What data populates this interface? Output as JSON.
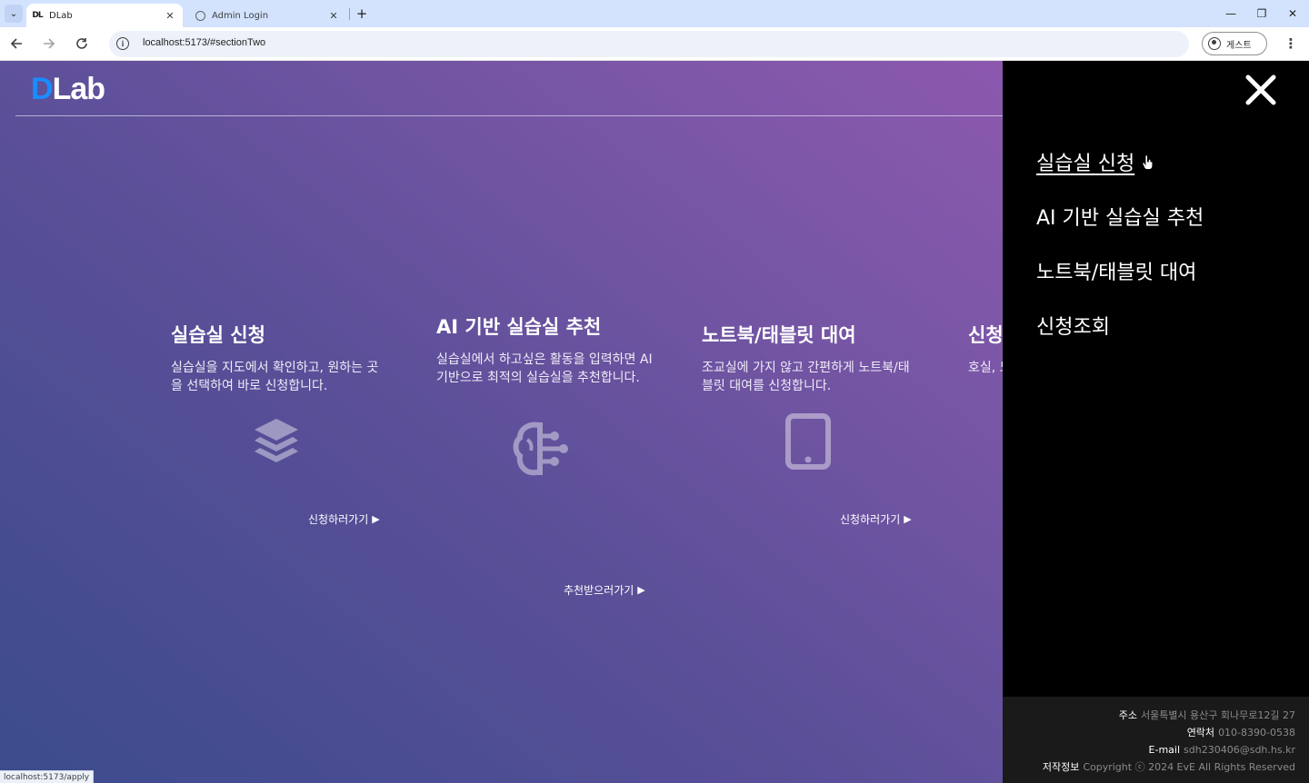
{
  "browser": {
    "tabs": [
      {
        "title": "DLab",
        "favicon": "dlab-favicon",
        "active": true
      },
      {
        "title": "Admin Login",
        "favicon": "globe-icon",
        "active": false
      }
    ],
    "address": "localhost:5173/#sectionTwo",
    "profile_label": "게스트",
    "status_url": "localhost:5173/apply"
  },
  "page": {
    "logo": {
      "first": "D",
      "rest": "Lab",
      "accent": "#1a8cff"
    },
    "cards": [
      {
        "title": "실습실 신청",
        "desc": "실습실을 지도에서 확인하고, 원하는 곳을 선택하여 바로 신청합니다.",
        "icon": "layers-icon",
        "cta": "신청하러가기"
      },
      {
        "title": "AI 기반 실습실 추천",
        "desc": "실습실에서 하고싶은 활동을 입력하면 AI 기반으로 최적의 실습실을 추천합니다.",
        "icon": "ai-brain-icon",
        "cta": "추천받으러가기"
      },
      {
        "title": "노트북/태블릿 대여",
        "desc": "조교실에 가지 않고 간편하게 노트북/태블릿 대여를 신청합니다.",
        "icon": "tablet-icon",
        "cta": "신청하러가기"
      },
      {
        "title": "신청",
        "desc": "호실, 노트북/태블릿"
      }
    ]
  },
  "menu": {
    "items": [
      "실습실 신청",
      "AI 기반 실습실 추천",
      "노트북/태블릿 대여",
      "신청조회"
    ],
    "footer": {
      "address_label": "주소",
      "address": "서울특별시 용산구 회나무로12길 27",
      "contact_label": "연락처",
      "contact": "010-8390-0538",
      "email_label": "E-mail",
      "email": "sdh230406@sdh.hs.kr",
      "copyright_label": "저작정보",
      "copyright": "Copyright ⓒ 2024 EvE All Rights Reserved"
    }
  },
  "colors": {
    "menu_bg": "#000000",
    "footer_bg": "#1a1a1a",
    "gradient_top": "#9859b3",
    "gradient_bottom": "#3b4b8c"
  }
}
